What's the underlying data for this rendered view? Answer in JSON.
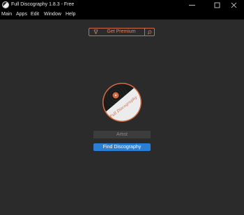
{
  "window": {
    "title": "Full Discography 1.8.3 - Free",
    "minimize_icon": "minimize-icon",
    "maximize_icon": "maximize-icon",
    "close_icon": "close-icon"
  },
  "menu": {
    "items": [
      "Main",
      "Apps",
      "Edit",
      "Window",
      "Help"
    ]
  },
  "premium": {
    "label": "Get Premium",
    "icon": "crown-icon",
    "search_icon": "search-icon"
  },
  "logo": {
    "icon": "vinyl-record-logo",
    "text": "Full Discography"
  },
  "search": {
    "placeholder": "Artist",
    "value": ""
  },
  "action": {
    "label": "Find Discography"
  },
  "colors": {
    "background": "#2b2b2b",
    "titlebar": "#000000",
    "accent_orange": "#d06a4e",
    "accent_blue": "#2a7fd4",
    "input_bg": "#3c3c3c"
  }
}
